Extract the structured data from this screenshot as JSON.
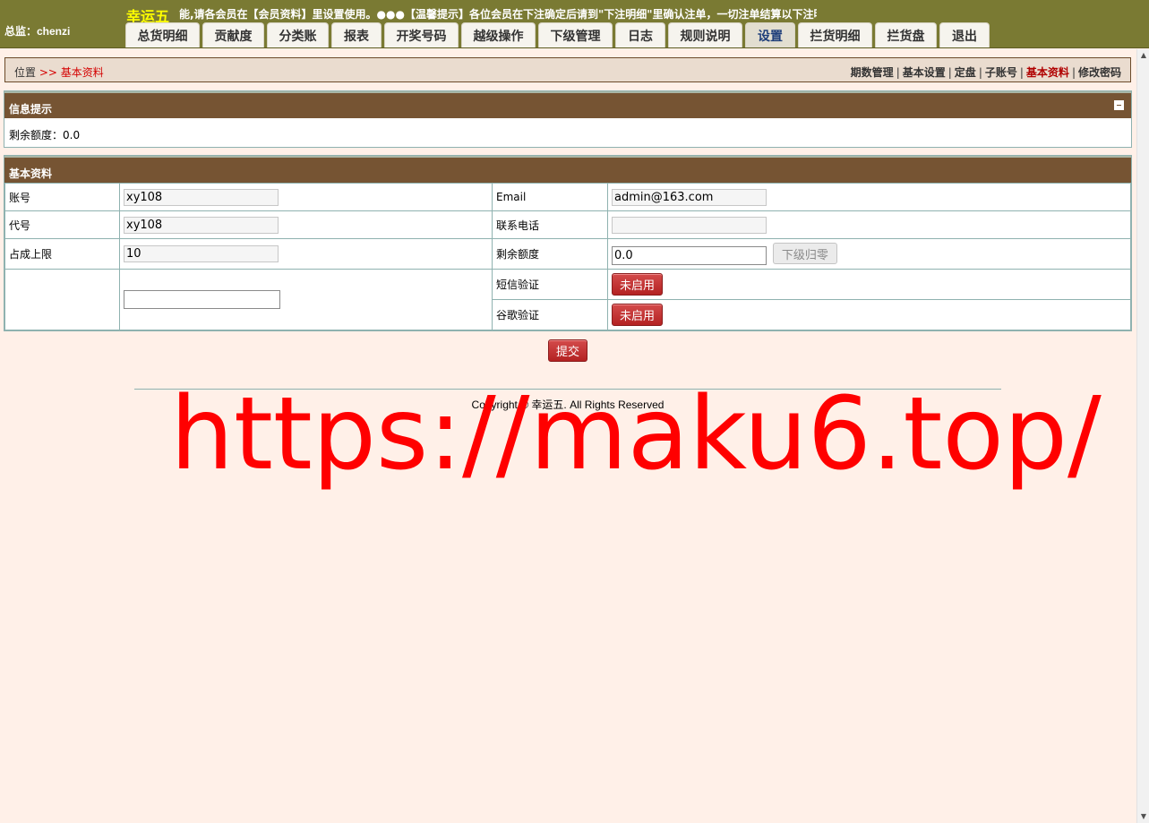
{
  "header": {
    "user_label": "总监：chenzi",
    "site_title": "幸运五",
    "marquee": "能,请各会员在【会员资料】里设置使用。●●●【温馨提示】各位会员在下注确定后请到\"下注明细\"里确认注单，一切注单结算以下注明细",
    "tabs": [
      {
        "label": "总货明细"
      },
      {
        "label": "贡献度"
      },
      {
        "label": "分类账"
      },
      {
        "label": "报表"
      },
      {
        "label": "开奖号码"
      },
      {
        "label": "越级操作"
      },
      {
        "label": "下级管理"
      },
      {
        "label": "日志"
      },
      {
        "label": "规则说明"
      },
      {
        "label": "设置"
      },
      {
        "label": "拦货明细"
      },
      {
        "label": "拦货盘"
      },
      {
        "label": "退出"
      }
    ],
    "active_tab": "设置"
  },
  "breadcrumb": {
    "root": "位置",
    "sep": ">>",
    "current": "基本资料"
  },
  "sublinks": [
    "期数管理",
    "基本设置",
    "定盘",
    "子账号",
    "基本资料",
    "修改密码"
  ],
  "info_panel": {
    "title": "信息提示",
    "text": "剩余额度：0.0"
  },
  "profile_panel": {
    "title": "基本资料",
    "account_label": "账号",
    "account_value": "xy108",
    "code_label": "代号",
    "code_value": "xy108",
    "share_label": "占成上限",
    "share_value": "10",
    "email_label": "Email",
    "email_value": "admin@163.com",
    "phone_label": "联系电话",
    "phone_value": "",
    "balance_label": "剩余额度",
    "balance_value": "0.0",
    "reset_label": "下级归零",
    "sms_label": "短信验证",
    "sms_button": "未启用",
    "google_label": "谷歌验证",
    "google_button": "未启用",
    "extra_value": ""
  },
  "submit_label": "提交",
  "footer": {
    "copyright": "Copyright © 幸运五. All Rights Reserved"
  },
  "watermark": "https://maku6.top/",
  "colors": {
    "header_bg": "#7a7a33",
    "panel_head": "#765433",
    "page_bg": "#fff0e8",
    "accent_red": "#d40000"
  }
}
